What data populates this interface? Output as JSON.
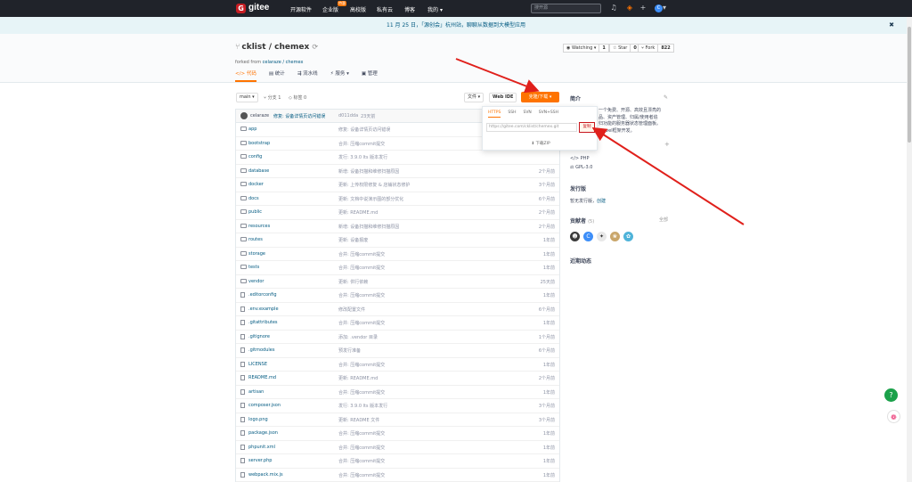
{
  "nav": {
    "logo_letter": "G",
    "logo_text": "gitee",
    "items": [
      "开源软件",
      "企业版",
      "高校版",
      "私有云",
      "博客",
      "我的"
    ],
    "badge": "特惠",
    "search_placeholder": "搜开源",
    "avatar_letter": "C"
  },
  "banner": {
    "text": "11 月 25 日，「源创会」杭州站，聊聊从数据到大模型应用",
    "close": "✖"
  },
  "repo": {
    "title": "cklist / chemex",
    "forked_prefix": "forked from",
    "forked_link": "celaraze / chemex",
    "watch_label": "Watching",
    "watch_count": "1",
    "star_label": "Star",
    "star_count": "0",
    "fork_label": "Fork",
    "fork_count": "822",
    "tabs": [
      "代码",
      "统计",
      "流水线",
      "服务",
      "管理"
    ]
  },
  "toolbar": {
    "branch": "main",
    "branches": "分支 1",
    "tags": "标签 0",
    "file_btn": "文件",
    "webide": "Web IDE",
    "clone": "克隆/下载"
  },
  "commit": {
    "author": "celaraze",
    "message": "修复: 设备详情页访问错误",
    "hash": "d011dda",
    "time": "23天前"
  },
  "files": [
    {
      "name": "app",
      "type": "dir",
      "msg": "修复: 设备详情页访问错误",
      "time": ""
    },
    {
      "name": "bootstrap",
      "type": "dir",
      "msg": "合并: 压缩commit提交",
      "time": ""
    },
    {
      "name": "config",
      "type": "dir",
      "msg": "发行: 3.9.0 lts 版本发行",
      "time": ""
    },
    {
      "name": "database",
      "type": "dir",
      "msg": "新增: 设备扫描和维修扫描原因",
      "time": "2个月前"
    },
    {
      "name": "docker",
      "type": "dir",
      "msg": "更新: 上传权限修复 & 店铺状态修护",
      "time": "3个月前"
    },
    {
      "name": "docs",
      "type": "dir",
      "msg": "更新: 文档中说演示图的部分优化",
      "time": "6个月前"
    },
    {
      "name": "public",
      "type": "dir",
      "msg": "更新: README.md",
      "time": "2个月前"
    },
    {
      "name": "resources",
      "type": "dir",
      "msg": "新增: 设备扫描和维修扫描原因",
      "time": "2个月前"
    },
    {
      "name": "routes",
      "type": "dir",
      "msg": "更新: 设备报废",
      "time": "1年前"
    },
    {
      "name": "storage",
      "type": "dir",
      "msg": "合并: 压缩commit提交",
      "time": "1年前"
    },
    {
      "name": "tests",
      "type": "dir",
      "msg": "合并: 压缩commit提交",
      "time": "1年前"
    },
    {
      "name": "vendor",
      "type": "dir",
      "msg": "更新: 供行依赖",
      "time": "25天前"
    },
    {
      "name": ".editorconfig",
      "type": "file",
      "msg": "合并: 压缩commit提交",
      "time": "1年前"
    },
    {
      "name": ".env.example",
      "type": "file",
      "msg": "修改配置文件",
      "time": "6个月前"
    },
    {
      "name": ".gitattributes",
      "type": "file",
      "msg": "合并: 压缩commit提交",
      "time": "1年前"
    },
    {
      "name": ".gitignore",
      "type": "file",
      "msg": "添加: .vendor 目录",
      "time": "1个月前"
    },
    {
      "name": ".gitmodules",
      "type": "file",
      "msg": "预发行准备",
      "time": "6个月前"
    },
    {
      "name": "LICENSE",
      "type": "file",
      "msg": "合并: 压缩commit提交",
      "time": "1年前"
    },
    {
      "name": "README.md",
      "type": "file",
      "msg": "更新: README.md",
      "time": "2个月前"
    },
    {
      "name": "artisan",
      "type": "file",
      "msg": "合并: 压缩commit提交",
      "time": "1年前"
    },
    {
      "name": "composer.json",
      "type": "file",
      "msg": "发行: 3.9.0 lts 版本发行",
      "time": "3个月前"
    },
    {
      "name": "logo.png",
      "type": "file",
      "msg": "更新: README 文件",
      "time": "3个月前"
    },
    {
      "name": "package.json",
      "type": "file",
      "msg": "合并: 压缩commit提交",
      "time": "1年前"
    },
    {
      "name": "phpunit.xml",
      "type": "file",
      "msg": "合并: 压缩commit提交",
      "time": "1年前"
    },
    {
      "name": "server.php",
      "type": "file",
      "msg": "合并: 压缩commit提交",
      "time": "1年前"
    },
    {
      "name": "webpack.mix.js",
      "type": "file",
      "msg": "合并: 压缩commit提交",
      "time": "1年前"
    }
  ],
  "clone_pop": {
    "tabs": [
      "HTTPS",
      "SSH",
      "SVN",
      "SVN+SSH"
    ],
    "url": "https://gitee.com/cklist/chemex.git",
    "copy": "复制",
    "zip": "下载ZIP"
  },
  "sidebar": {
    "intro_title": "简介",
    "intro_lines": [
      "一个免费、开源、高效且漂亮的",
      "品、资产管理、归属/使用者追",
      "归功能的服务器状态管理面板。",
      "aravel框架开发。"
    ],
    "lang": "PHP",
    "license": "GPL-3.0",
    "release_title": "发行版",
    "release_text": "暂无发行版，",
    "release_link": "创建",
    "contrib_title": "贡献者",
    "contrib_count": "(5)",
    "contrib_all": "全部",
    "activity_title": "近期动态"
  },
  "colors": {
    "accent": "#fe7300",
    "nav_bg": "#20232a",
    "link": "#005980",
    "red": "#c7161e"
  }
}
